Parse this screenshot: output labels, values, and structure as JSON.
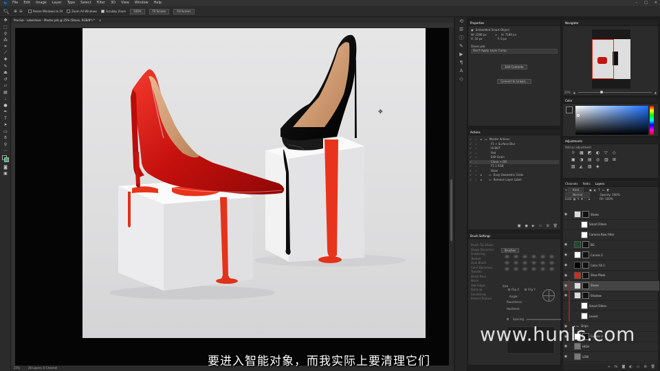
{
  "menu": {
    "items": [
      "File",
      "Edit",
      "Image",
      "Layer",
      "Type",
      "Select",
      "Filter",
      "3D",
      "View",
      "Window",
      "Help"
    ],
    "app_icon": "Ps"
  },
  "options": {
    "resize_windows": "Resize Windows to Fit",
    "zoom_all": "Zoom All Windows",
    "scrubby_zoom": "Scrubby Zoom",
    "btn_100": "100%",
    "fit_screen": "Fit Screen",
    "fill_screen": "Fill Screen"
  },
  "document": {
    "tab": "Proclub - Labeshoes - Master.psb @ 25% (Shoes, RGB/8*) *",
    "zoom": "25%",
    "status": "28 Layers, 0 Channel"
  },
  "tools": [
    "move",
    "marquee",
    "lasso",
    "wand",
    "crop",
    "eyedropper",
    "heal",
    "brush",
    "stamp",
    "history",
    "eraser",
    "gradient",
    "blur",
    "dodge",
    "pen",
    "type",
    "path-select",
    "shape",
    "hand",
    "zoom",
    "more",
    "fg-bg"
  ],
  "properties": {
    "title": "Properties",
    "object_type": "Embedded Smart Object",
    "w_label": "W:",
    "w_value": "2286 px",
    "h_label": "H:",
    "h_value": "7186 px",
    "x_label": "X:",
    "x_value": "16 px",
    "y_label": "Y:",
    "y_value": "0 px",
    "layer_name": "Shoes.psb",
    "layer_comp": "Don't Apply Layer Comp",
    "edit_contents": "Edit Contents",
    "convert_linked": "Convert to Linked..."
  },
  "actions": {
    "title": "Actions",
    "items": [
      "Master Actions",
      "F5 + Surface Blur",
      "Hi BOT",
      "Pad",
      "Edit Grain",
      "Clone + DR",
      "F5 1 RGB",
      "Shoe",
      "Easy Geometric Grids",
      "Remove Layer Label"
    ]
  },
  "brush": {
    "title": "Brush Settings",
    "brushes_btn": "Brushes",
    "options": [
      "Brush Tip Shape",
      "Shape Dynamics",
      "Scattering",
      "Texture",
      "Dual Brush",
      "Color Dynamics",
      "Transfer",
      "Brush Pose",
      "Noise",
      "Wet Edges",
      "Build-up",
      "Smoothing",
      "Protect Texture"
    ],
    "size_label": "Size",
    "angle_label": "Angle:",
    "roundness_label": "Roundness:",
    "hardness_label": "Hardness",
    "spacing_label": "Spacing",
    "flip_x": "Flip X",
    "flip_y": "Flip Y"
  },
  "navigator": {
    "title": "Navigator",
    "zoom": "25%"
  },
  "color": {
    "title": "Color"
  },
  "adjustments": {
    "title": "Adjustments",
    "subtitle": "Add an adjustment"
  },
  "layers": {
    "tabs": [
      "Channels",
      "Paths",
      "Layers"
    ],
    "kind": "Kind",
    "mode": "Normal",
    "opacity_label": "Opacity:",
    "opacity": "100%",
    "fill_label": "Fill:",
    "fill": "100%",
    "lock_label": "Lock:",
    "items": [
      {
        "name": "Shoes",
        "type": "smart"
      },
      {
        "name": "Smart Filters",
        "type": "filter"
      },
      {
        "name": "Camera Raw Filter",
        "type": "filter"
      },
      {
        "name": "BG",
        "type": "adj"
      },
      {
        "name": "Curves 2",
        "type": "adj"
      },
      {
        "name": "Color Fill 1",
        "type": "fill"
      },
      {
        "name": "Shoe Mask",
        "type": "fill"
      },
      {
        "name": "Shoes",
        "type": "smart"
      },
      {
        "name": "Shadow",
        "type": "smart"
      },
      {
        "name": "Smart Filters",
        "type": "filter"
      },
      {
        "name": "Levels",
        "type": "filter"
      },
      {
        "name": "Drips",
        "type": "group"
      },
      {
        "name": "Curves 3",
        "type": "adj"
      },
      {
        "name": "HIGH",
        "type": "pixel"
      },
      {
        "name": "LOW",
        "type": "pixel"
      }
    ]
  },
  "subtitle": "要进入智能对象，而我实际上要清理它们",
  "watermark": "www.hunls.com",
  "colors": {
    "red_shoe": "#d0140f",
    "drip": "#e8341c",
    "accent": "#31a8ff"
  }
}
